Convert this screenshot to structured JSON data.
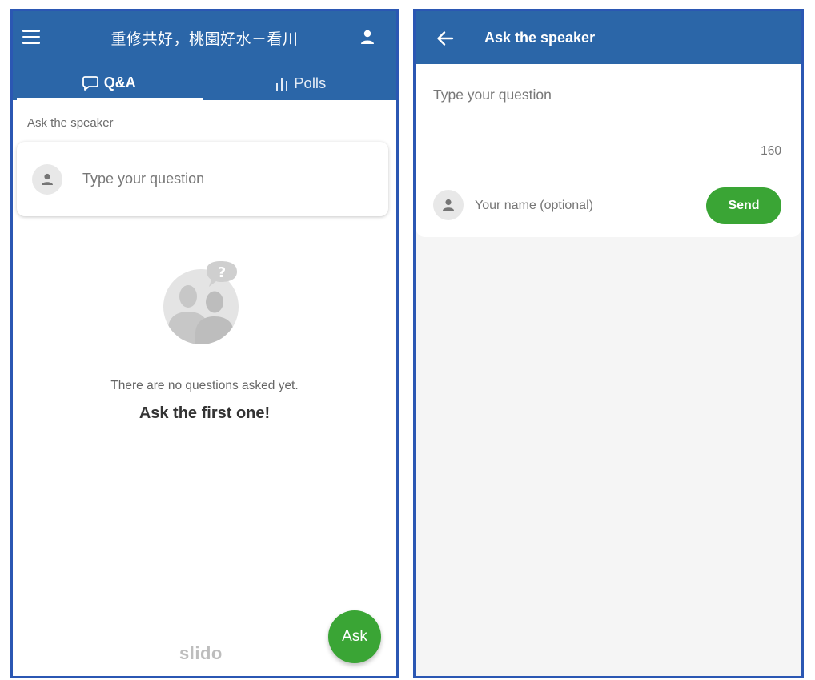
{
  "left_screen": {
    "header": {
      "title": "重修共好，桃園好水－看川"
    },
    "tabs": [
      {
        "label": "Q&A",
        "active": true
      },
      {
        "label": "Polls",
        "active": false
      }
    ],
    "section_label": "Ask the speaker",
    "question_card": {
      "placeholder": "Type your question"
    },
    "empty_state": {
      "message": "There are no questions asked yet.",
      "cta": "Ask the first one!",
      "bubble_glyph": "?"
    },
    "brand": "slido",
    "ask_button_label": "Ask"
  },
  "right_screen": {
    "header": {
      "title": "Ask the speaker"
    },
    "compose": {
      "placeholder": "Type your question",
      "char_counter": "160",
      "name_placeholder": "Your name (optional)",
      "send_label": "Send"
    }
  },
  "colors": {
    "header_bg": "#2b66a8",
    "frame_border": "#2b57b3",
    "accent_green": "#3aa535",
    "right_bg": "#f5f5f5"
  },
  "icons": {
    "menu": "menu-icon",
    "profile": "profile-icon",
    "qa_tab": "chat-bubble-icon",
    "polls_tab": "bar-chart-icon",
    "avatar": "person-icon",
    "back": "arrow-left-icon",
    "illustration": "people-question-icon"
  }
}
